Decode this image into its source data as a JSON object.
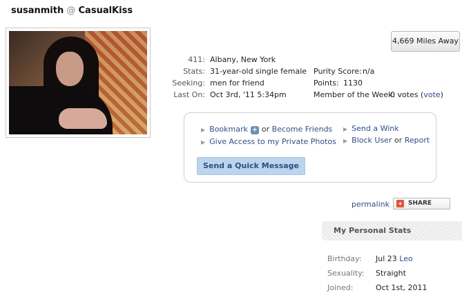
{
  "header": {
    "username": "susanmith",
    "at": "@",
    "site": "CasualKiss"
  },
  "distance": "4,669 Miles Away",
  "profile": {
    "location_label": "411:",
    "location": "Albany, New York",
    "stats_label": "Stats:",
    "stats": "31-year-old single female",
    "seeking_label": "Seeking:",
    "seeking": "men for friend",
    "last_on_label": "Last On:",
    "last_on": "Oct 3rd, '11 5:34pm",
    "purity_label": "Purity Score:",
    "purity": "n/a",
    "points_label": "Points:",
    "points": "1130",
    "motw_label": "Member of the Week:",
    "motw_votes": "0 votes",
    "motw_open": "(",
    "motw_vote": "vote",
    "motw_close": ")"
  },
  "actions": {
    "bookmark": "Bookmark",
    "or_become": "or",
    "become_friends": "Become Friends",
    "private_photos": "Give Access to my Private Photos",
    "send_wink": "Send a Wink",
    "block_user": "Block User",
    "or_report": "or",
    "report": "Report",
    "quick_message": "Send a Quick Message"
  },
  "share": {
    "permalink": "permalink",
    "share": "SHARE"
  },
  "personal_stats": {
    "title": "My Personal Stats",
    "birthday_label": "Birthday:",
    "birthday": "Jul 23",
    "sign": "Leo",
    "sexuality_label": "Sexuality:",
    "sexuality": "Straight",
    "joined_label": "Joined:",
    "joined": "Oct 1st, 2011"
  }
}
